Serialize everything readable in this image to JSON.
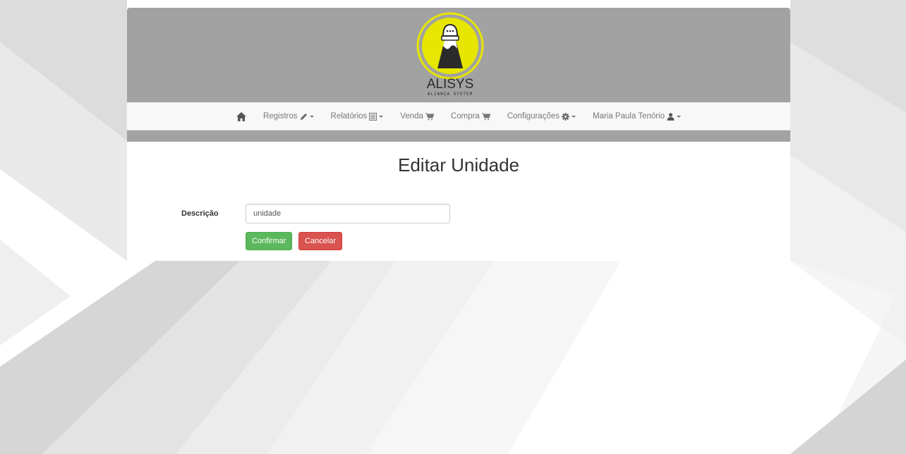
{
  "brand": {
    "name": "ALISYS",
    "tagline": "ALIANÇA SYSTEM"
  },
  "nav": {
    "items": [
      {
        "label": "Registros",
        "icon": "pencil-icon"
      },
      {
        "label": "Relatórios",
        "icon": "list-icon"
      },
      {
        "label": "Venda",
        "icon": "cart-icon"
      },
      {
        "label": "Compra",
        "icon": "cart-icon"
      },
      {
        "label": "Configurações",
        "icon": "gear-icon"
      },
      {
        "label": "Maria Paula Tenório",
        "icon": "user-icon"
      }
    ]
  },
  "page": {
    "title": "Editar Unidade"
  },
  "form": {
    "descricao_label": "Descrição",
    "descricao_value": "unidade"
  },
  "buttons": {
    "confirm": "Confirmar",
    "cancel": "Cancelar"
  },
  "colors": {
    "header": "#a2a2a2",
    "logo_yellow": "#e6e600",
    "confirm": "#5cb85c",
    "cancel": "#d9534f"
  }
}
